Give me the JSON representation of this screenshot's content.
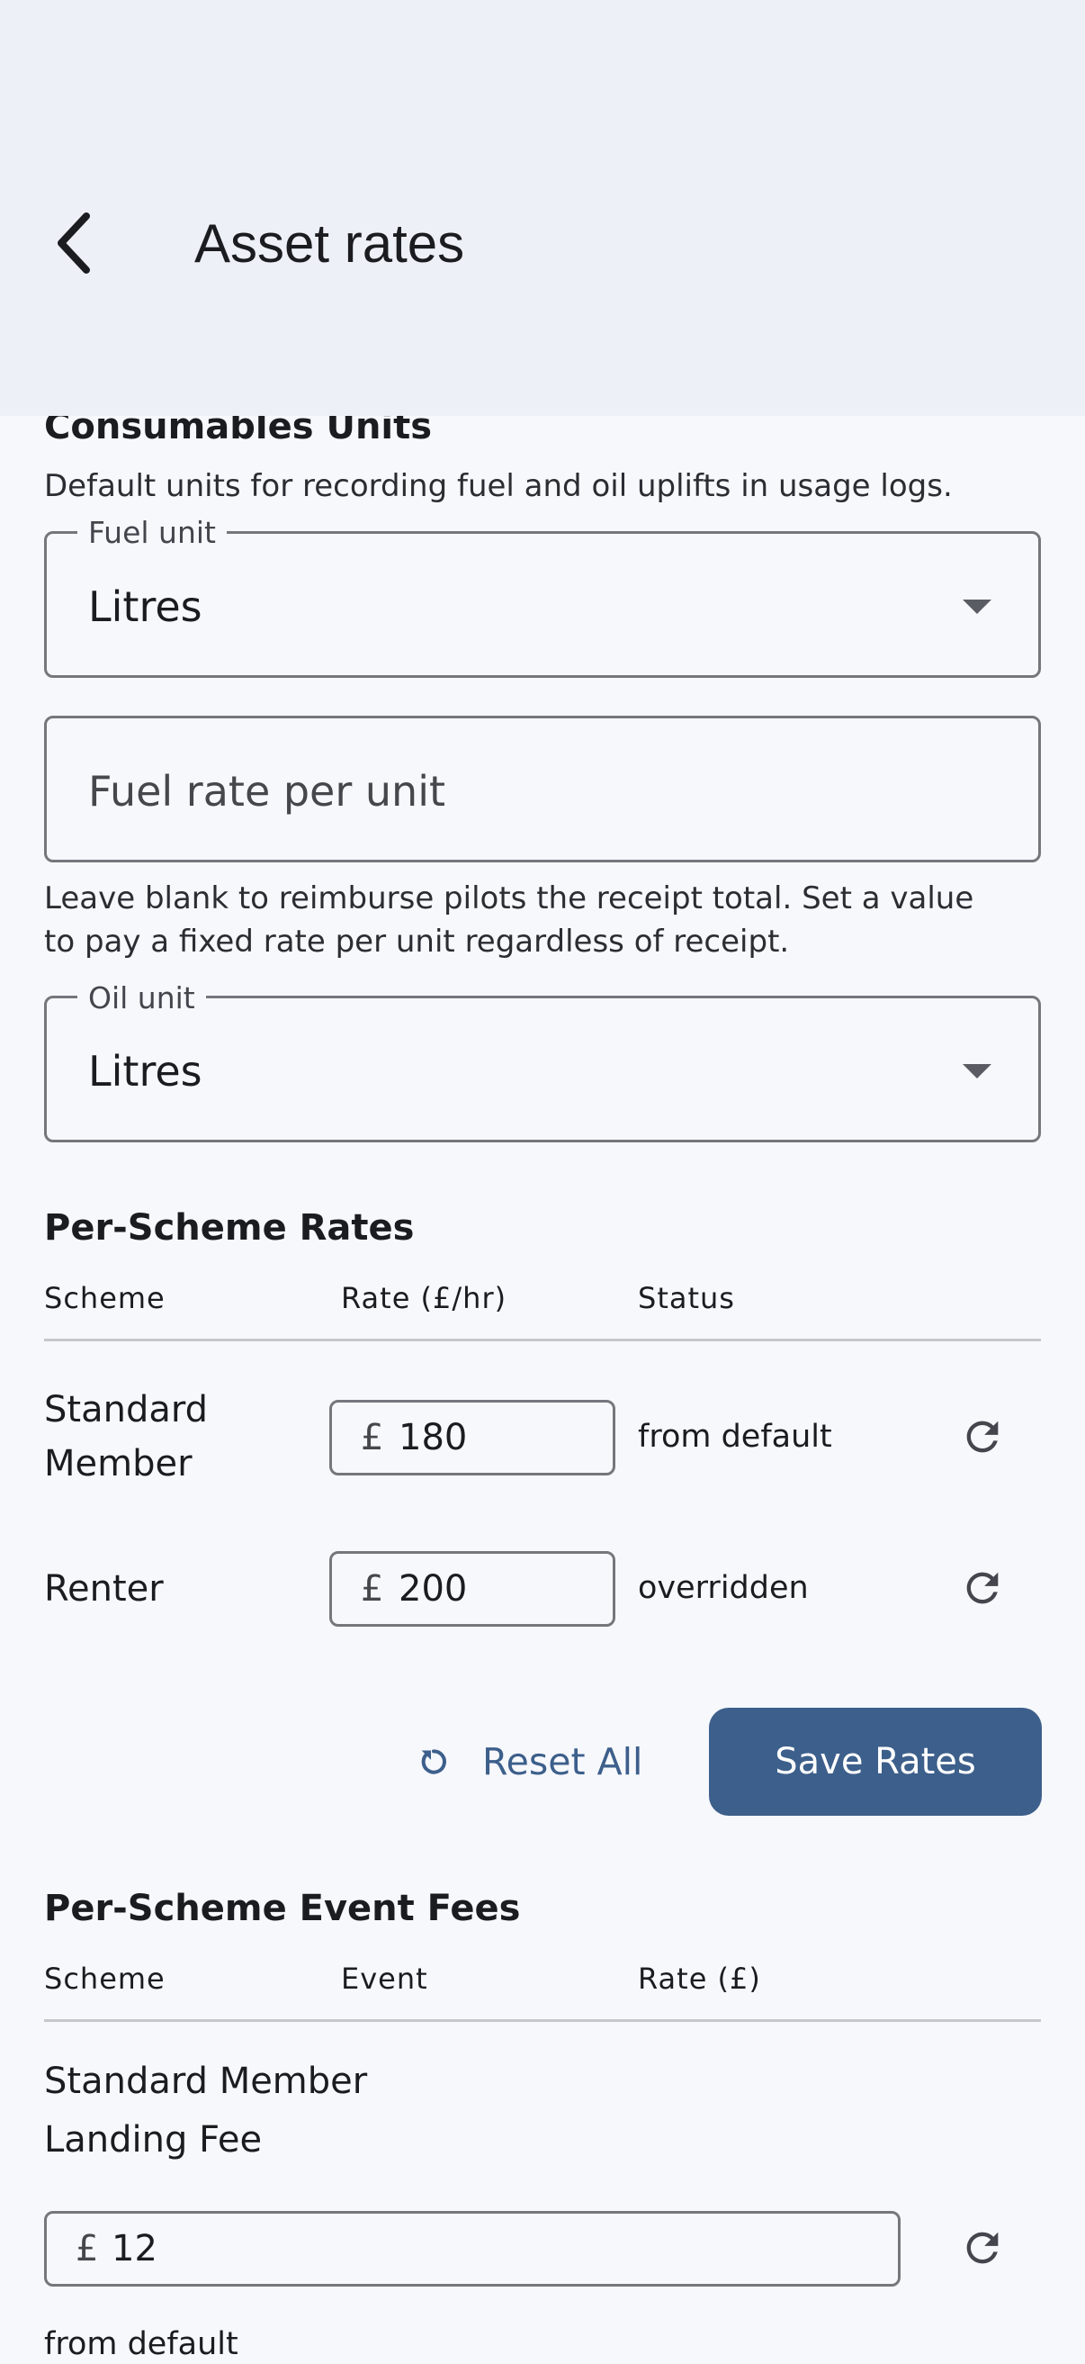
{
  "app_bar": {
    "title": "Asset rates"
  },
  "consumables": {
    "heading": "Consumables Units",
    "description": "Default units for recording fuel and oil uplifts in usage logs.",
    "fuel_unit": {
      "label": "Fuel unit",
      "value": "Litres"
    },
    "fuel_rate": {
      "placeholder": "Fuel rate per unit"
    },
    "helper_line1": "Leave blank to reimburse pilots the receipt total. Set a value",
    "helper_line2": "to pay a fixed rate per unit regardless of receipt.",
    "oil_unit": {
      "label": "Oil unit",
      "value": "Litres"
    }
  },
  "per_scheme_rates": {
    "heading": "Per-Scheme Rates",
    "columns": [
      "Scheme",
      "Rate (£/hr)",
      "Status"
    ],
    "currency": "£",
    "rows": [
      {
        "scheme_line1": "Standard",
        "scheme_line2": "Member",
        "rate": "180",
        "status": "from default"
      },
      {
        "scheme_line1": "Renter",
        "scheme_line2": "",
        "rate": "200",
        "status": "overridden"
      }
    ],
    "reset_all_label": "Reset All",
    "save_label": "Save Rates"
  },
  "event_fees": {
    "heading": "Per-Scheme Event Fees",
    "columns": [
      "Scheme",
      "Event",
      "Rate (£)"
    ],
    "currency": "£",
    "rows": [
      {
        "scheme": "Standard Member",
        "event": "Landing Fee",
        "rate": "12",
        "status": "from default"
      }
    ]
  },
  "colors": {
    "primary": "#3d5f8b",
    "app_bar_bg": "#edf0f7",
    "page_bg": "#f7f8fc",
    "outline": "#76777d"
  }
}
